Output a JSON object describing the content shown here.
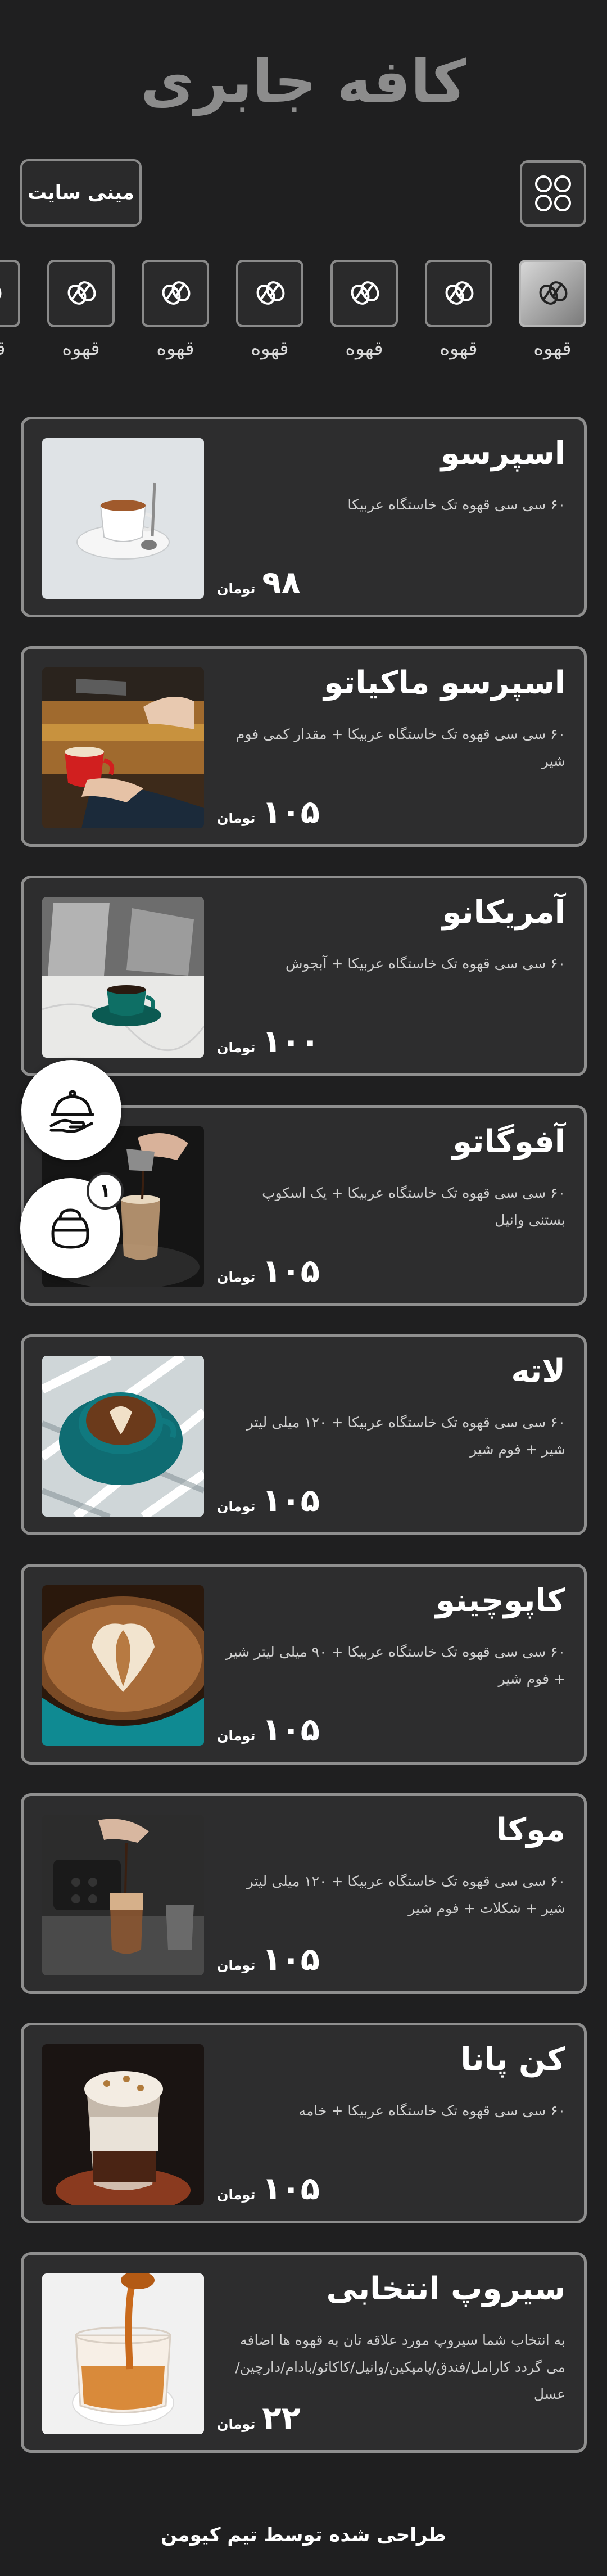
{
  "header": {
    "title": "کافه جابری",
    "mini_site_label": "مینی سایت",
    "grid_icon": "grid-icon"
  },
  "categories": [
    {
      "label": "قهوه",
      "icon": "coffee-bean-icon",
      "active": true
    },
    {
      "label": "قهوه",
      "icon": "coffee-bean-icon",
      "active": false
    },
    {
      "label": "قهوه",
      "icon": "coffee-bean-icon",
      "active": false
    },
    {
      "label": "قهوه",
      "icon": "coffee-bean-icon",
      "active": false
    },
    {
      "label": "قهوه",
      "icon": "coffee-bean-icon",
      "active": false
    },
    {
      "label": "قهوه",
      "icon": "coffee-bean-icon",
      "active": false
    },
    {
      "label": "قهوه",
      "icon": "coffee-bean-icon",
      "active": false
    }
  ],
  "menu": {
    "currency": "تومان",
    "items": [
      {
        "name": "اسپرسو",
        "desc": "۶۰ سی سی قهوه تک خاستگاه عربیکا",
        "price": "۹۸"
      },
      {
        "name": "اسپرسو ماکیاتو",
        "desc": "۶۰ سی سی قهوه تک خاستگاه عربیکا + مقدار کمی فوم شیر",
        "price": "۱۰۵"
      },
      {
        "name": "آمریکانو",
        "desc": "۶۰ سی سی قهوه تک خاستگاه عربیکا + آبجوش",
        "price": "۱۰۰"
      },
      {
        "name": "آفوگاتو",
        "desc": "۶۰ سی سی قهوه تک خاستگاه عربیکا + یک اسکوپ بستنی وانیل",
        "price": "۱۰۵"
      },
      {
        "name": "لاته",
        "desc": "۶۰ سی سی قهوه تک خاستگاه عربیکا + ۱۲۰ میلی لیتر شیر + فوم شیر",
        "price": "۱۰۵"
      },
      {
        "name": "کاپوچینو",
        "desc": "۶۰ سی سی قهوه تک خاستگاه عربیکا + ۹۰ میلی لیتر شیر + فوم شیر",
        "price": "۱۰۵"
      },
      {
        "name": "موکا",
        "desc": "۶۰ سی سی قهوه تک خاستگاه عربیکا + ۱۲۰ میلی لیتر شیر + شکلات + فوم شیر",
        "price": "۱۰۵"
      },
      {
        "name": "کن پانا",
        "desc": "۶۰ سی سی قهوه تک خاستگاه عربیکا + خامه",
        "price": "۱۰۵"
      },
      {
        "name": "سیروپ انتخابی",
        "desc": "به انتخاب شما سیروپ مورد علاقه تان به قهوه ها اضافه می گردد کارامل/فندق/پامپکین/وانیل/کاکائو/بادام/دارچین/عسل",
        "price": "۲۲"
      }
    ]
  },
  "floating": {
    "waiter_icon": "waiter-service-icon",
    "cart_icon": "order-bag-icon",
    "cart_count": "۱"
  },
  "footer": {
    "text": "طراحی شده توسط تیم کیومن"
  },
  "colors": {
    "background": "#1f1f20",
    "card": "#2d2d2e",
    "border": "#8f8f8f",
    "title": "#8c8c8c"
  }
}
